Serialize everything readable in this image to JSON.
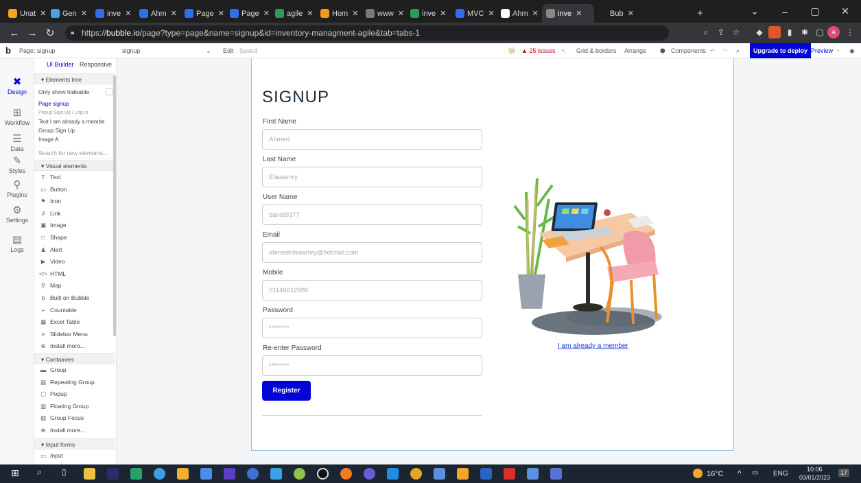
{
  "browser": {
    "tabs": [
      {
        "label": "Unat",
        "color": "#f5a623"
      },
      {
        "label": "Gen",
        "color": "#4aa3df"
      },
      {
        "label": "inve",
        "color": "#2f6fed"
      },
      {
        "label": "Ahm",
        "color": "#2f6fed"
      },
      {
        "label": "Page",
        "color": "#2f6fed"
      },
      {
        "label": "Page",
        "color": "#2f6fed"
      },
      {
        "label": "agile",
        "color": "#2c9b5a"
      },
      {
        "label": "Hom",
        "color": "#f29a1b"
      },
      {
        "label": "www",
        "color": "#7a7a7a"
      },
      {
        "label": "inve",
        "color": "#2c9b5a"
      },
      {
        "label": "MVC",
        "color": "#2f6fed"
      },
      {
        "label": "Ahm",
        "color": "#ffffff"
      },
      {
        "label": "inve",
        "color": "#888888"
      },
      {
        "label": "Bub",
        "color": "#1f1f1f"
      }
    ],
    "url_prefix": "https://",
    "url_host": "bubble.io",
    "url_path": "/page?type=page&name=signup&id=inventory-managment-agile&tab=tabs-1"
  },
  "editor": {
    "page_label": "Page: signup",
    "page_select": "signup",
    "edit": "Edit",
    "saved": "Saved",
    "issues": "25 issues",
    "grid": "Grid & borders",
    "arrange": "Arrange",
    "components": "Components",
    "upgrade": "Upgrade to deploy",
    "preview": "Preview"
  },
  "rail": [
    {
      "label": "Design",
      "icon": "design-icon",
      "glyph": "✖"
    },
    {
      "label": "Workflow",
      "icon": "workflow-icon",
      "glyph": "⊞"
    },
    {
      "label": "Data",
      "icon": "database-icon",
      "glyph": "☰"
    },
    {
      "label": "Styles",
      "icon": "brush-icon",
      "glyph": "✎"
    },
    {
      "label": "Plugins",
      "icon": "plugin-icon",
      "glyph": "⚲"
    },
    {
      "label": "Settings",
      "icon": "gear-icon",
      "glyph": "⚙"
    },
    {
      "label": "Logs",
      "icon": "document-icon",
      "glyph": "▤"
    }
  ],
  "palette": {
    "tab_ui": "UI Builder",
    "tab_responsive": "Responsive",
    "elements_tree": "Elements tree",
    "only_hideable": "Only show hideable",
    "tree": [
      "Page signup",
      "Popup Sign Up / Log In",
      "Text I am already a membe",
      "Group Sign Up",
      "Image A"
    ],
    "search_placeholder": "Search for new elements...",
    "visual_header": "Visual elements",
    "visual": [
      {
        "label": "Text",
        "glyph": "T"
      },
      {
        "label": "Button",
        "glyph": "▭"
      },
      {
        "label": "Icon",
        "glyph": "⚑"
      },
      {
        "label": "Link",
        "glyph": "∂"
      },
      {
        "label": "Image",
        "glyph": "▣"
      },
      {
        "label": "Shape",
        "glyph": "□"
      },
      {
        "label": "Alert",
        "glyph": "♟"
      },
      {
        "label": "Video",
        "glyph": "▶"
      },
      {
        "label": "HTML",
        "glyph": "</>"
      },
      {
        "label": "Map",
        "glyph": "⚲"
      },
      {
        "label": "Built on Bubble",
        "glyph": "b"
      },
      {
        "label": "Countable",
        "glyph": "+"
      },
      {
        "label": "Excel Table",
        "glyph": "▦"
      },
      {
        "label": "Slidebar Menu",
        "glyph": "≡"
      },
      {
        "label": "Install more...",
        "glyph": "⊕"
      }
    ],
    "containers_header": "Containers",
    "containers": [
      {
        "label": "Group",
        "glyph": "▬"
      },
      {
        "label": "Repeating Group",
        "glyph": "▤"
      },
      {
        "label": "Popup",
        "glyph": "▢"
      },
      {
        "label": "Floating Group",
        "glyph": "▥"
      },
      {
        "label": "Group Focus",
        "glyph": "▧"
      },
      {
        "label": "Install more...",
        "glyph": "⊕"
      }
    ],
    "inputs_header": "Input forms",
    "inputs": [
      {
        "label": "Input",
        "glyph": "▭"
      }
    ]
  },
  "form": {
    "title": "SIGNUP",
    "fields": [
      {
        "label": "First Name",
        "placeholder": "Ahmed"
      },
      {
        "label": "Last Name",
        "placeholder": "Elawamry"
      },
      {
        "label": "User Name",
        "placeholder": "dante9377"
      },
      {
        "label": "Email",
        "placeholder": "ahmedelawamry@hotmail.com"
      },
      {
        "label": "Mobile",
        "placeholder": "01146612880"
      },
      {
        "label": "Password",
        "placeholder": "********"
      },
      {
        "label": "Re-enter Password",
        "placeholder": "********"
      }
    ],
    "register": "Register",
    "member_link": "I am already a member"
  },
  "taskbar": {
    "weather": "16°C",
    "lang": "ENG",
    "time": "10:06",
    "date": "03/01/2023",
    "notifications": "17"
  }
}
